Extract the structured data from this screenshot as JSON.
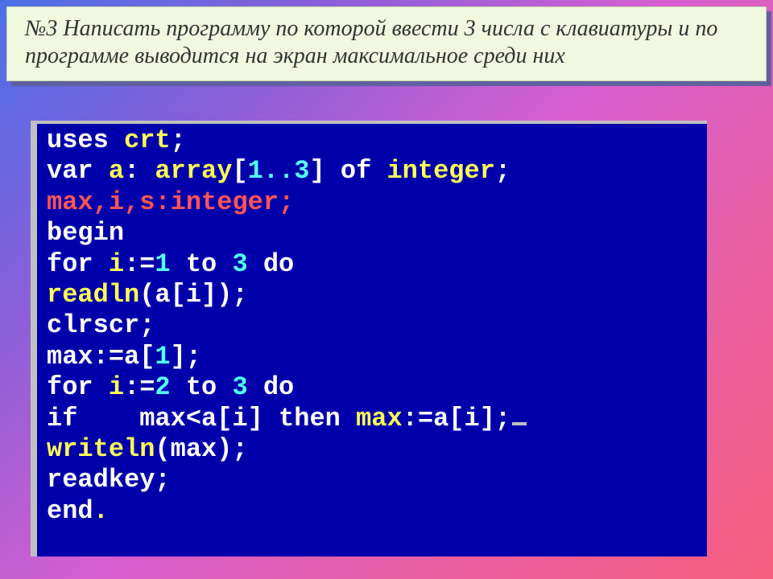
{
  "task": {
    "text": "№3  Написать программу по которой ввести 3 числа с клавиатуры и по программе выводится на экран максимальное среди них"
  },
  "code": {
    "lines": [
      [
        {
          "t": "uses ",
          "c": "white"
        },
        {
          "t": "crt",
          "c": "yellow"
        },
        {
          "t": ";",
          "c": "white"
        }
      ],
      [
        {
          "t": "var ",
          "c": "white"
        },
        {
          "t": "a",
          "c": "yellow"
        },
        {
          "t": ": ",
          "c": "white"
        },
        {
          "t": "array",
          "c": "yellow"
        },
        {
          "t": "[",
          "c": "white"
        },
        {
          "t": "1..3",
          "c": "cyan"
        },
        {
          "t": "] ",
          "c": "white"
        },
        {
          "t": "of ",
          "c": "white"
        },
        {
          "t": "integer",
          "c": "yellow"
        },
        {
          "t": ";",
          "c": "white"
        }
      ],
      [
        {
          "t": "max,i,s:integer;",
          "c": "red"
        }
      ],
      [
        {
          "t": "begin",
          "c": "white"
        }
      ],
      [
        {
          "t": "for ",
          "c": "white"
        },
        {
          "t": "i",
          "c": "yellow"
        },
        {
          "t": ":=",
          "c": "white"
        },
        {
          "t": "1",
          "c": "cyan"
        },
        {
          "t": " to ",
          "c": "white"
        },
        {
          "t": "3",
          "c": "cyan"
        },
        {
          "t": " do",
          "c": "white"
        }
      ],
      [
        {
          "t": "readln",
          "c": "yellow"
        },
        {
          "t": "(a[i]);",
          "c": "white"
        }
      ],
      [
        {
          "t": "clrscr;",
          "c": "white"
        }
      ],
      [
        {
          "t": "max:=a[",
          "c": "white"
        },
        {
          "t": "1",
          "c": "cyan"
        },
        {
          "t": "];",
          "c": "white"
        }
      ],
      [
        {
          "t": "for ",
          "c": "white"
        },
        {
          "t": "i",
          "c": "yellow"
        },
        {
          "t": ":=",
          "c": "white"
        },
        {
          "t": "2",
          "c": "cyan"
        },
        {
          "t": " to ",
          "c": "white"
        },
        {
          "t": "3",
          "c": "cyan"
        },
        {
          "t": " do",
          "c": "white"
        }
      ],
      [
        {
          "t": "if",
          "c": "white"
        },
        {
          "t": "    max<a[i] ",
          "c": "white"
        },
        {
          "t": "then ",
          "c": "white"
        },
        {
          "t": "max",
          "c": "yellow"
        },
        {
          "t": ":=a[i];",
          "c": "white"
        }
      ],
      [
        {
          "t": "writeln",
          "c": "yellow"
        },
        {
          "t": "(max);",
          "c": "white"
        }
      ],
      [
        {
          "t": "readkey;",
          "c": "white"
        }
      ],
      [
        {
          "t": "end",
          "c": "white"
        },
        {
          "t": ".",
          "c": "yellow"
        }
      ]
    ],
    "cursor_line": 9
  }
}
